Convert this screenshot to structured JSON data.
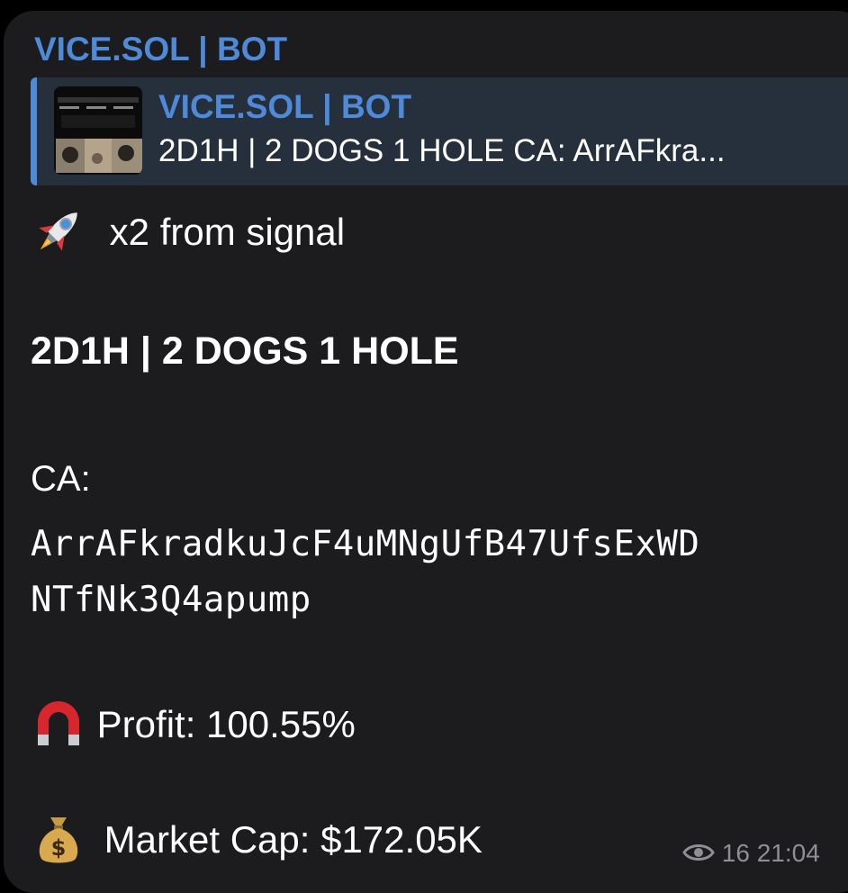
{
  "message": {
    "sender": "VICE.SOL | BOT",
    "reply": {
      "title": "VICE.SOL | BOT",
      "text": "2D1H | 2 DOGS 1 HOLE CA: ArrAFkra..."
    },
    "signal_line": "x2 from signal",
    "token_name": "2D1H | 2 DOGS 1 HOLE",
    "ca_label": "CA:",
    "ca_line1": "ArrAFkradkuJcF4uMNgUfB47UfsExWD",
    "ca_line2": "NTfNk3Q4apump",
    "profit": "Profit: 100.55%",
    "market_cap": "Market Cap: $172.05K",
    "views": "16",
    "time": "21:04",
    "icons": {
      "signal": "rocket-icon",
      "profit": "magnet-icon",
      "market_cap": "money-bag-icon",
      "views": "eye-icon"
    },
    "colors": {
      "accent": "#4e8ad8",
      "bubble": "#1c1c1e",
      "reply_bg": "#26303c",
      "meta": "#8e8e93"
    }
  }
}
